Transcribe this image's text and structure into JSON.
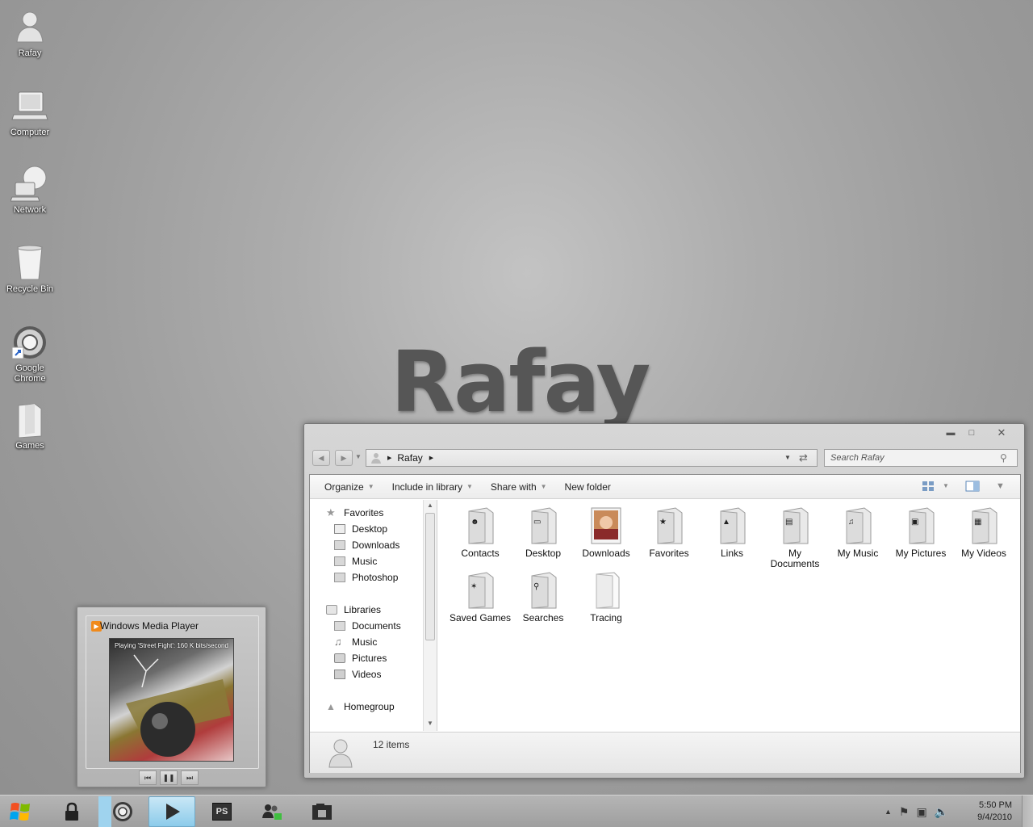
{
  "desktop": {
    "icons": [
      {
        "label": "Rafay",
        "icon": "user-folder-icon"
      },
      {
        "label": "Computer",
        "icon": "computer-icon"
      },
      {
        "label": "Network",
        "icon": "network-icon"
      },
      {
        "label": "Recycle Bin",
        "icon": "recycle-bin-icon"
      },
      {
        "label": "Google Chrome",
        "icon": "chrome-icon"
      },
      {
        "label": "Games",
        "icon": "games-folder-icon"
      }
    ],
    "wallpaper_text": "Rafay"
  },
  "explorer": {
    "breadcrumb": [
      "Rafay"
    ],
    "search_placeholder": "Search Rafay",
    "toolbar": {
      "organize": "Organize",
      "include_in_library": "Include in library",
      "share_with": "Share with",
      "new_folder": "New folder"
    },
    "nav": {
      "favorites": {
        "label": "Favorites",
        "items": [
          "Desktop",
          "Downloads",
          "Music",
          "Photoshop"
        ]
      },
      "libraries": {
        "label": "Libraries",
        "items": [
          "Documents",
          "Music",
          "Pictures",
          "Videos"
        ]
      },
      "homegroup": {
        "label": "Homegroup"
      }
    },
    "folders": [
      {
        "name": "Contacts",
        "emblem": "contacts-emblem"
      },
      {
        "name": "Desktop",
        "emblem": "desktop-emblem"
      },
      {
        "name": "Downloads",
        "emblem": "downloads-thumbnail"
      },
      {
        "name": "Favorites",
        "emblem": "star-emblem"
      },
      {
        "name": "Links",
        "emblem": "links-emblem"
      },
      {
        "name": "My Documents",
        "emblem": "document-emblem"
      },
      {
        "name": "My Music",
        "emblem": "music-emblem"
      },
      {
        "name": "My Pictures",
        "emblem": "camera-emblem"
      },
      {
        "name": "My Videos",
        "emblem": "video-emblem"
      },
      {
        "name": "Saved Games",
        "emblem": "gamepad-emblem"
      },
      {
        "name": "Searches",
        "emblem": "magnifier-emblem"
      },
      {
        "name": "Tracing",
        "emblem": "blank-emblem"
      }
    ],
    "status": {
      "item_count": "12 items"
    }
  },
  "wmp": {
    "title": "Windows Media Player",
    "now_playing": "Playing 'Street Fight': 160 K bits/second"
  },
  "taskbar": {
    "apps": [
      "lock-icon",
      "chrome-icon",
      "media-player-icon",
      "photoshop-icon",
      "messenger-icon",
      "explorer-icon"
    ],
    "photoshop_label": "PS",
    "clock": {
      "time": "5:50 PM",
      "date": "9/4/2010"
    }
  },
  "colors": {
    "wallpaper": "#a8a8a8",
    "wordmark": "#565656",
    "taskbar": "#aaaaaa",
    "active_task": "#9fd3ee"
  }
}
